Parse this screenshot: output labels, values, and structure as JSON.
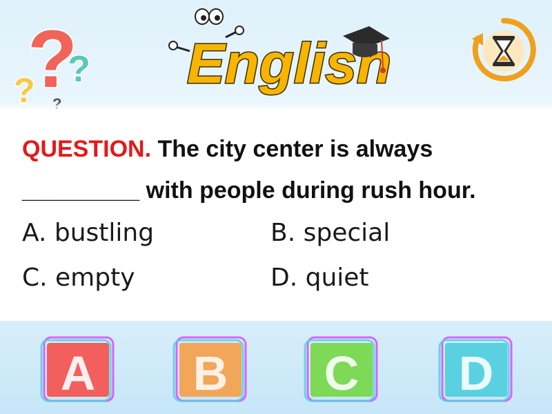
{
  "header": {
    "logo_text": "English"
  },
  "question": {
    "label": "QUESTION.",
    "line1": "The city center is always",
    "blank": "_________",
    "line2": "with people during rush hour."
  },
  "options": {
    "a": "A. bustling",
    "b": "B. special",
    "c": "C. empty",
    "d": "D. quiet"
  },
  "answer_buttons": [
    {
      "letter": "A",
      "color": "#f25f5c"
    },
    {
      "letter": "B",
      "color": "#f2a65a"
    },
    {
      "letter": "C",
      "color": "#7ed957"
    },
    {
      "letter": "D",
      "color": "#5ad1e0"
    }
  ],
  "colors": {
    "question_label": "#e01b1b",
    "logo_fill": "#f7b500",
    "timer_ring": "#f0a11b"
  },
  "icons": [
    "question-marks-icon",
    "hourglass-timer-icon",
    "graduation-cap-icon"
  ]
}
